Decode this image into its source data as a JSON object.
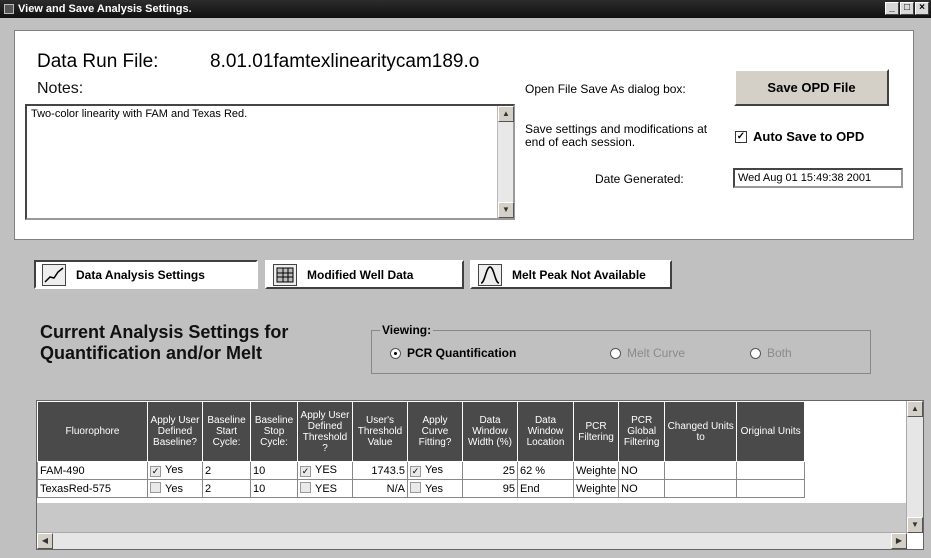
{
  "window": {
    "title": "View and Save Analysis Settings."
  },
  "header": {
    "data_run_label": "Data Run File:",
    "data_run_value": "8.01.01famtexlinearitycam189.o",
    "notes_label": "Notes:",
    "notes_value": "Two-color linearity with FAM and Texas Red.",
    "open_label": "Open File Save As dialog box:",
    "save_opd_label": "Save OPD File",
    "save_settings_label": "Save settings and modifications at end of each session.",
    "autosave_label": "Auto Save to OPD",
    "autosave_checked": true,
    "date_label": "Date Generated:",
    "date_value": "Wed Aug 01 15:49:38 2001"
  },
  "tabs": [
    {
      "label": "Data Analysis Settings",
      "icon": "chart-icon",
      "selected": true
    },
    {
      "label": "Modified Well Data",
      "icon": "grid-icon",
      "selected": false
    },
    {
      "label": "Melt Peak Not Available",
      "icon": "peak-icon",
      "selected": false
    }
  ],
  "analysis": {
    "title_line1": "Current  Analysis Settings for",
    "title_line2": "Quantification and/or Melt",
    "viewing_label": "Viewing:",
    "options": [
      {
        "label": "PCR Quantification",
        "selected": true,
        "enabled": true
      },
      {
        "label": "Melt Curve",
        "selected": false,
        "enabled": false
      },
      {
        "label": "Both",
        "selected": false,
        "enabled": false
      }
    ]
  },
  "grid": {
    "columns": [
      "Fluorophore",
      "Apply User Defined Baseline?",
      "Baseline Start Cycle:",
      "Baseline Stop Cycle:",
      "Apply User Defined Threshold ?",
      "User's Threshold Value",
      "Apply Curve Fitting?",
      "Data Window Width (%)",
      "Data Window Location",
      "PCR Filtering",
      "PCR Global Filtering",
      "Changed Units to",
      "Original Units"
    ],
    "rows": [
      {
        "fluor": "FAM-490",
        "baseline_check": true,
        "baseline_text": "Yes",
        "start": "2",
        "stop": "10",
        "threshold_check": true,
        "threshold_text": "YES",
        "threshold_value": "1743.5",
        "curve_check": true,
        "curve_text": "Yes",
        "width": "25",
        "location": "62 %",
        "pcr_filter": "Weighte",
        "global": "NO",
        "changed": "",
        "original": ""
      },
      {
        "fluor": "TexasRed-575",
        "baseline_check": false,
        "baseline_text": "Yes",
        "start": "2",
        "stop": "10",
        "threshold_check": false,
        "threshold_text": "YES",
        "threshold_value": "N/A",
        "curve_check": false,
        "curve_text": "Yes",
        "width": "95",
        "location": "End",
        "pcr_filter": "Weighte",
        "global": "NO",
        "changed": "",
        "original": ""
      }
    ]
  }
}
